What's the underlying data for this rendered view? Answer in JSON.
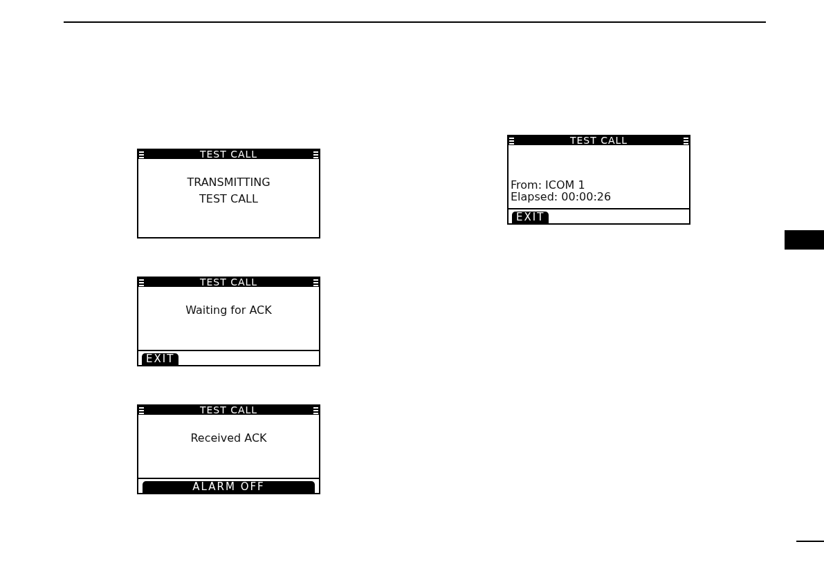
{
  "left_column": [
    {
      "title": "TEST CALL",
      "kind": "message",
      "lines": [
        "TRANSMITTING",
        "TEST CALL"
      ]
    },
    {
      "title": "TEST CALL",
      "kind": "message",
      "lines": [
        "Waiting for ACK"
      ],
      "softkeys": [
        {
          "label": "EXIT",
          "kind": "short"
        }
      ]
    },
    {
      "title": "TEST CALL",
      "kind": "message",
      "lines": [
        "Received ACK"
      ],
      "softkeys": [
        {
          "label": "ALARM OFF",
          "kind": "wide"
        }
      ]
    }
  ],
  "right_column": [
    {
      "title": "TEST CALL",
      "kind": "details",
      "lines": [
        "From: ICOM 1",
        "Elapsed: 00:00:26"
      ],
      "softkeys": [
        {
          "label": "EXIT",
          "kind": "short"
        }
      ]
    }
  ]
}
